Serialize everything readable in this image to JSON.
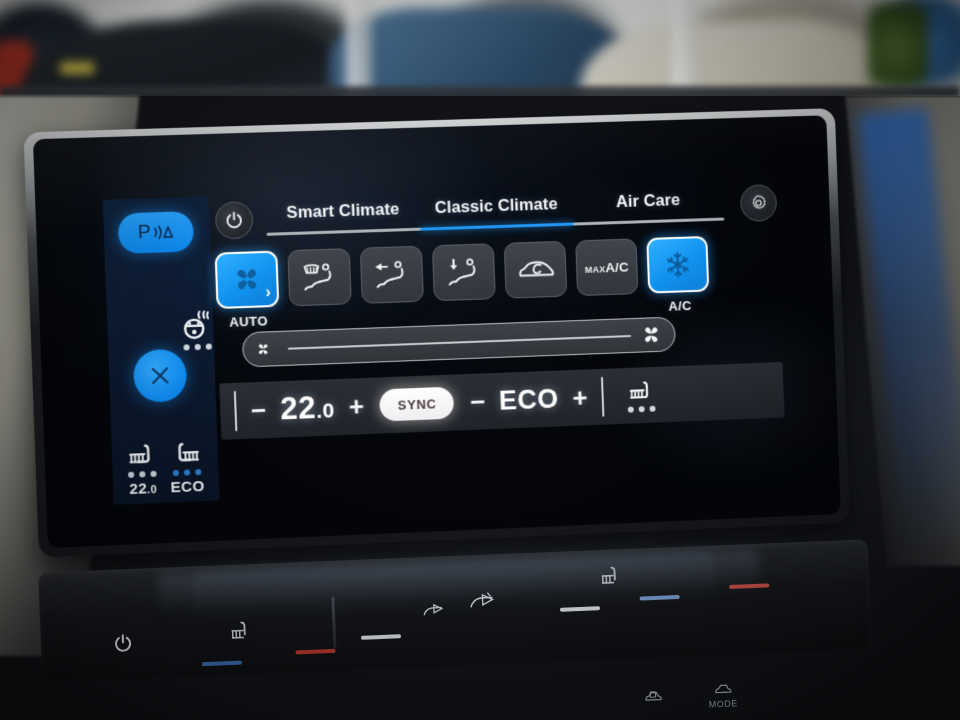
{
  "scene": {
    "description": "Volkswagen ID.3 infotainment touchscreen showing the Classic Climate menu"
  },
  "left_rail": {
    "pdc_button": {
      "label": "P",
      "icon": "park-distance-control-icon"
    },
    "close_button": {
      "icon": "close-x-icon"
    },
    "seat_left": {
      "icon": "seat-heater-icon",
      "label": "22.0",
      "label_whole": "22",
      "label_frac": ".0",
      "dots": [
        "on",
        "on",
        "on"
      ]
    },
    "seat_right": {
      "icon": "seat-heater-icon",
      "label": "ECO",
      "dots": [
        "blue",
        "blue",
        "blue"
      ]
    }
  },
  "tabbar": {
    "power_button": {
      "icon": "power-icon"
    },
    "settings_button": {
      "icon": "gear-icon"
    },
    "tabs": [
      {
        "label": "Smart Climate",
        "active": false
      },
      {
        "label": "Classic Climate",
        "active": true
      },
      {
        "label": "Air Care",
        "active": false
      }
    ],
    "active_index": 1
  },
  "mode_buttons": [
    {
      "name": "auto-climate-button",
      "icon": "fan-icon",
      "caption": "AUTO",
      "active": true,
      "chevron": "›"
    },
    {
      "name": "defrost-seat-vent-button",
      "icon": "windscreen-defrost-seat-icon",
      "caption": "",
      "active": false
    },
    {
      "name": "face-vent-button",
      "icon": "face-vent-seat-icon",
      "caption": "",
      "active": false
    },
    {
      "name": "footwell-vent-button",
      "icon": "footwell-vent-seat-icon",
      "caption": "",
      "active": false
    },
    {
      "name": "recirculation-button",
      "icon": "air-recirculation-car-icon",
      "caption": "",
      "active": false
    },
    {
      "name": "max-ac-button",
      "icon": null,
      "text_small": "MAX",
      "text_large": "A/C",
      "caption": "",
      "active": false
    },
    {
      "name": "ac-button",
      "icon": "snowflake-icon",
      "caption": "A/C",
      "active": true
    }
  ],
  "fan_slider": {
    "icon_low": "fan-small-icon",
    "icon_high": "fan-large-icon",
    "value_percent": 0
  },
  "steering_wheel_heater": {
    "icon": "steering-wheel-heater-icon",
    "dots": [
      "on",
      "on",
      "on"
    ]
  },
  "seat_heater_mid": {
    "icon": "seat-heater-icon",
    "dots": [
      "on",
      "on",
      "on"
    ]
  },
  "bottom_bar": {
    "temperature": {
      "minus": "−",
      "value": "22.0",
      "value_whole": "22",
      "value_frac": ".0",
      "plus": "+"
    },
    "sync": {
      "label": "SYNC",
      "active": true
    },
    "eco": {
      "minus": "−",
      "value": "ECO",
      "plus": "+"
    },
    "seat_heater_right": {
      "icon": "seat-heater-icon",
      "dots": [
        "on",
        "on",
        "on"
      ]
    }
  },
  "hardware_controls": {
    "power": {
      "icon": "power-icon"
    },
    "defrost_front": {
      "icon": "front-defrost-icon"
    },
    "defrost_rear": {
      "icon": "rear-defrost-icon"
    },
    "center_buttons": [
      {
        "label": "",
        "icon": "car-lock-icon"
      },
      {
        "label": "MODE",
        "icon": "drive-mode-icon"
      }
    ]
  },
  "colors": {
    "accent_blue": "#1192ef",
    "active_border": "#ffffff",
    "panel_dark": "#2b2f35",
    "rail_bg": "#11243e",
    "text_white": "#f3f5f7",
    "tab_track": "#aeb3ba"
  }
}
